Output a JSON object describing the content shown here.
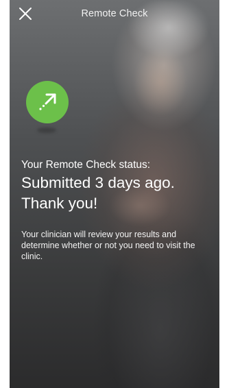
{
  "header": {
    "title": "Remote Check",
    "close_icon": "close-icon"
  },
  "status": {
    "badge_icon": "arrow-up-right-icon",
    "badge_color": "#6cc04a",
    "label": "Your Remote Check status:",
    "headline_line1": "Submitted 3 days ago.",
    "headline_line2": "Thank you!",
    "message": "Your clinician will review your results and determine whether or not you need to visit the clinic."
  }
}
